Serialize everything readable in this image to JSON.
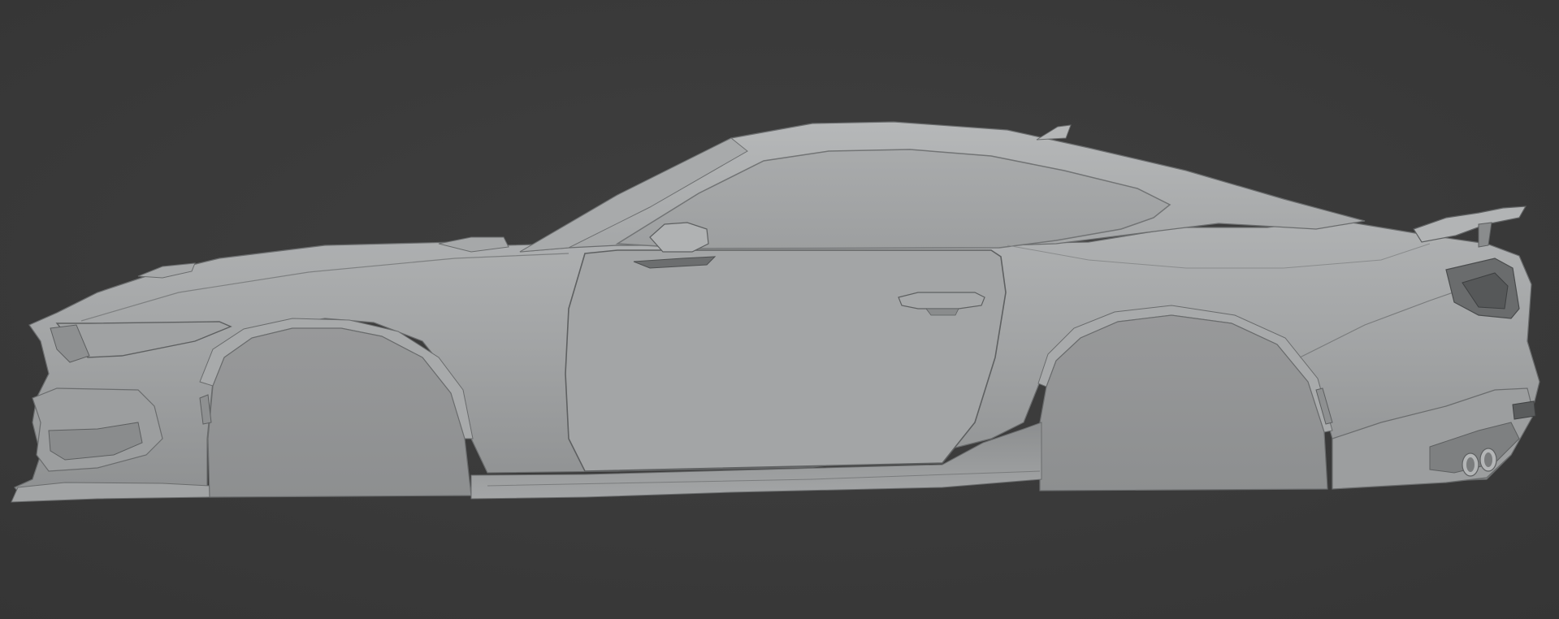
{
  "viewport": {
    "background_color": "#3a3a3a",
    "background_center_color": "#3f3f3f",
    "model_base_color": "#9a9c9d",
    "model_highlight_color": "#b4b6b7",
    "model_shadow_color": "#7a7c7d",
    "model_edge_color": "#5e6061",
    "model_dark_part_color": "#4a4c4d"
  }
}
